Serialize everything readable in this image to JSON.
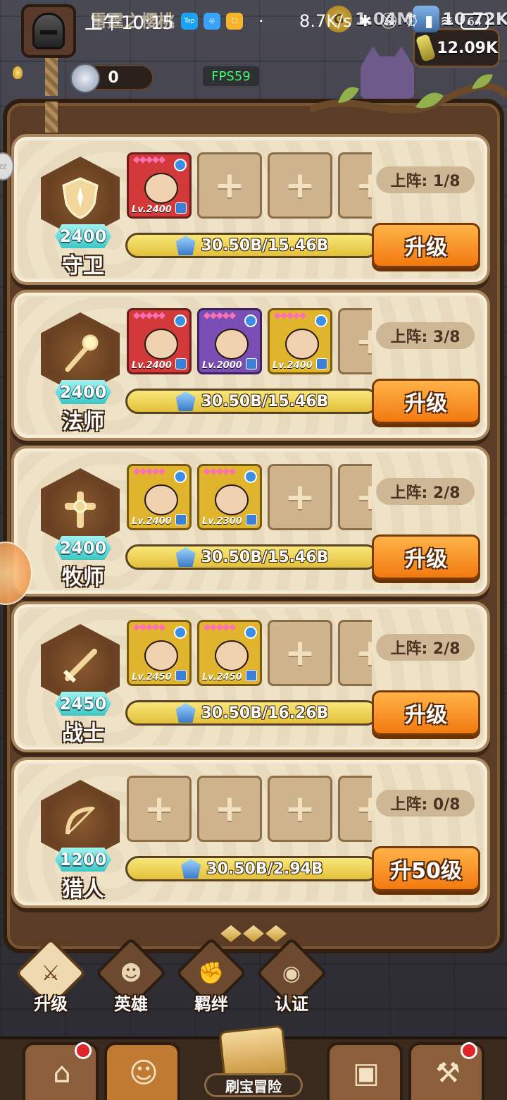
{
  "status_bar": {
    "time": "上午10:15",
    "speed": "8.7K/s",
    "battery": "64"
  },
  "hud": {
    "player_name": "雷霆之樱桃",
    "gold": "1.04M",
    "gems": "10.72K",
    "scrolls": "12.09K",
    "silver_coins": "0",
    "fps": "FPS59"
  },
  "rows": [
    {
      "class_name": "守卫",
      "power": "2400",
      "emblem": "shield-icon",
      "deploy": "上阵: 1/8",
      "cost": "30.50B/15.46B",
      "button": "升级",
      "heroes": [
        {
          "level": "Lv.2400",
          "rarity": "red",
          "stars": "◆◆◆◆◆"
        }
      ]
    },
    {
      "class_name": "法师",
      "power": "2400",
      "emblem": "staff-icon",
      "deploy": "上阵: 3/8",
      "cost": "30.50B/15.46B",
      "button": "升级",
      "heroes": [
        {
          "level": "Lv.2400",
          "rarity": "red",
          "stars": "◆◆◆◆◆"
        },
        {
          "level": "Lv.2000",
          "rarity": "purple",
          "stars": "◆◆◆◆◆"
        },
        {
          "level": "Lv.2400",
          "rarity": "gold",
          "stars": "◆◆◆◆◆"
        }
      ]
    },
    {
      "class_name": "牧师",
      "power": "2400",
      "emblem": "cross-icon",
      "deploy": "上阵: 2/8",
      "cost": "30.50B/15.46B",
      "button": "升级",
      "heroes": [
        {
          "level": "Lv.2400",
          "rarity": "gold",
          "stars": "◆◆◆◆◆"
        },
        {
          "level": "Lv.2300",
          "rarity": "gold",
          "stars": "◆◆◆◆◆"
        }
      ]
    },
    {
      "class_name": "战士",
      "power": "2450",
      "emblem": "sword-icon",
      "deploy": "上阵: 2/8",
      "cost": "30.50B/16.26B",
      "button": "升级",
      "heroes": [
        {
          "level": "Lv.2450",
          "rarity": "gold",
          "stars": "◆◆◆◆◆"
        },
        {
          "level": "Lv.2450",
          "rarity": "gold",
          "stars": "◆◆◆◆◆"
        }
      ]
    },
    {
      "class_name": "猎人",
      "power": "1200",
      "emblem": "bow-icon",
      "deploy": "上阵: 0/8",
      "cost": "30.50B/2.94B",
      "button": "升50级",
      "heroes": []
    }
  ],
  "sub_tabs": [
    {
      "label": "升级",
      "icon": "sword-upgrade-icon",
      "active": true
    },
    {
      "label": "英雄",
      "icon": "hero-icon",
      "active": false
    },
    {
      "label": "羁绊",
      "icon": "fist-icon",
      "active": false
    },
    {
      "label": "认证",
      "icon": "eye-icon",
      "active": false
    }
  ],
  "bottom_nav": {
    "center_label": "刷宝冒险",
    "items": [
      "shop-icon",
      "hero-avatar-icon",
      "chest-icon",
      "forge-icon"
    ]
  },
  "colors": {
    "upgrade_button": "#f27a10",
    "power_badge": "#3fc6c6",
    "cost_bar": "#e3c03a"
  }
}
